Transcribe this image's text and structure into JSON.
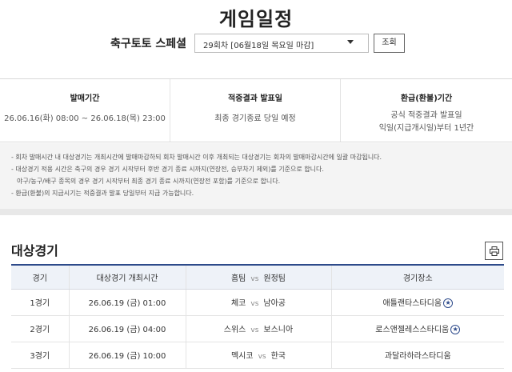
{
  "page": {
    "title": "게임일정"
  },
  "selector": {
    "label": "축구토토 스페셜",
    "value": "29회차 [06월18일 목요일 마감]",
    "button_label": "조회"
  },
  "info": [
    {
      "head": "발매기간",
      "lines": [
        "26.06.16(화) 08:00 ~ 26.06.18(목) 23:00"
      ]
    },
    {
      "head": "적중결과 발표일",
      "lines": [
        "최종 경기종료 당일 예정"
      ]
    },
    {
      "head": "환급(환불)기간",
      "lines": [
        "공식 적중결과 발표일",
        "익일(지급개시일)부터 1년간"
      ]
    }
  ],
  "notes": [
    "- 회차 발매시간 내 대상경기는 개최시간에 발매마감하되 회차 발매시간 이후 개최되는 대상경기는 회차의 발매마감시간에 일괄 마감됩니다.",
    "- 대상경기 적용 시간은 축구의 경우 경기 시작부터 후반 경기 종료 시까지(연장전, 승부차기 제외)를 기준으로 합니다.",
    "야구/농구/배구 종목의 경우 경기 시작부터 최종 경기 종료 시까지(연장전 포함)를 기준으로 합니다.",
    "- 환급(환불)의 지급시기는 적중결과 발표 당일부터 지급 가능합니다."
  ],
  "section": {
    "title": "대상경기"
  },
  "table": {
    "headers": {
      "match": "경기",
      "time": "대상경기 개최시간",
      "home": "홈팀",
      "vs": "vs",
      "away": "원정팀",
      "venue": "경기장소"
    },
    "rows": [
      {
        "match": "1경기",
        "time": "26.06.19 (금) 01:00",
        "home": "체코",
        "vs": "vs",
        "away": "남아공",
        "venue": "애틀랜타스타디움",
        "star": "★"
      },
      {
        "match": "2경기",
        "time": "26.06.19 (금) 04:00",
        "home": "스위스",
        "vs": "vs",
        "away": "보스니아",
        "venue": "로스앤젤레스스타디움",
        "star": "★"
      },
      {
        "match": "3경기",
        "time": "26.06.19 (금) 10:00",
        "home": "멕시코",
        "vs": "vs",
        "away": "한국",
        "venue": "과달라하라스타디움",
        "star": ""
      }
    ]
  },
  "icons": {
    "select": "chevron-down-icon",
    "print": "printer-icon",
    "venue": "star-badge-icon"
  },
  "colors": {
    "accent": "#2d4a8a",
    "header_bg": "#eef2f8",
    "notes_bg": "#f4f4f4"
  }
}
